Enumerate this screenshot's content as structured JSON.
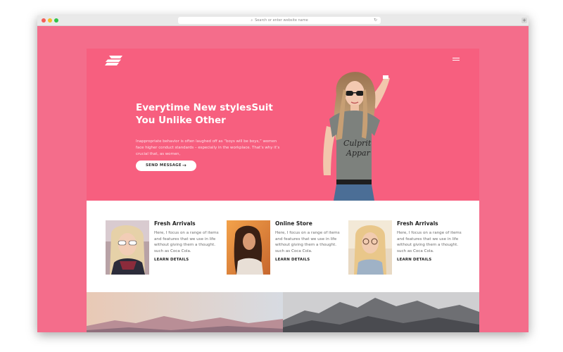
{
  "browser": {
    "address_placeholder": "Search or enter website name",
    "search_icon": "magnifier-icon",
    "reload_icon": "reload-icon",
    "new_tab_icon": "plus-icon",
    "new_tab_glyph": "+"
  },
  "site": {
    "logo_icon": "s-logo-icon",
    "menu_icon": "hamburger-icon",
    "hero": {
      "title": "Everytime New stylesSuit You Unlike Other",
      "description": "Inappropriate behavior is often laughed off as “boys will be boys,” women face higher conduct standards – especially in the workplace. That’s why it’s crucial that, as women,",
      "button_label": "SEND MESSAGE",
      "button_arrow": "→",
      "model_shirt_text_1": "Culprit",
      "model_shirt_text_2": "Appar",
      "background_color": "#f75f7f"
    },
    "features": [
      {
        "title": "Fresh Arrivals",
        "text": "Here, I focus on a range of items and features that we use in life without giving them a thought. such as Coca Cola.",
        "link": "LEARN DETAILS"
      },
      {
        "title": "Online Store",
        "text": "Here, I focus on a range of items and features that we use in life without giving them a thought. such as Coca Cola.",
        "link": "LEARN DETAILS"
      },
      {
        "title": "Fresh Arrivals",
        "text": "Here, I focus on a range of items and features that we use in life without giving them a thought. such as Coca Cola.",
        "link": "LEARN DETAILS"
      }
    ]
  },
  "colors": {
    "page_background": "#f46d8b",
    "hero_pink": "#f75f7f",
    "text_dark": "#222222",
    "text_muted": "#6b6b6b"
  }
}
